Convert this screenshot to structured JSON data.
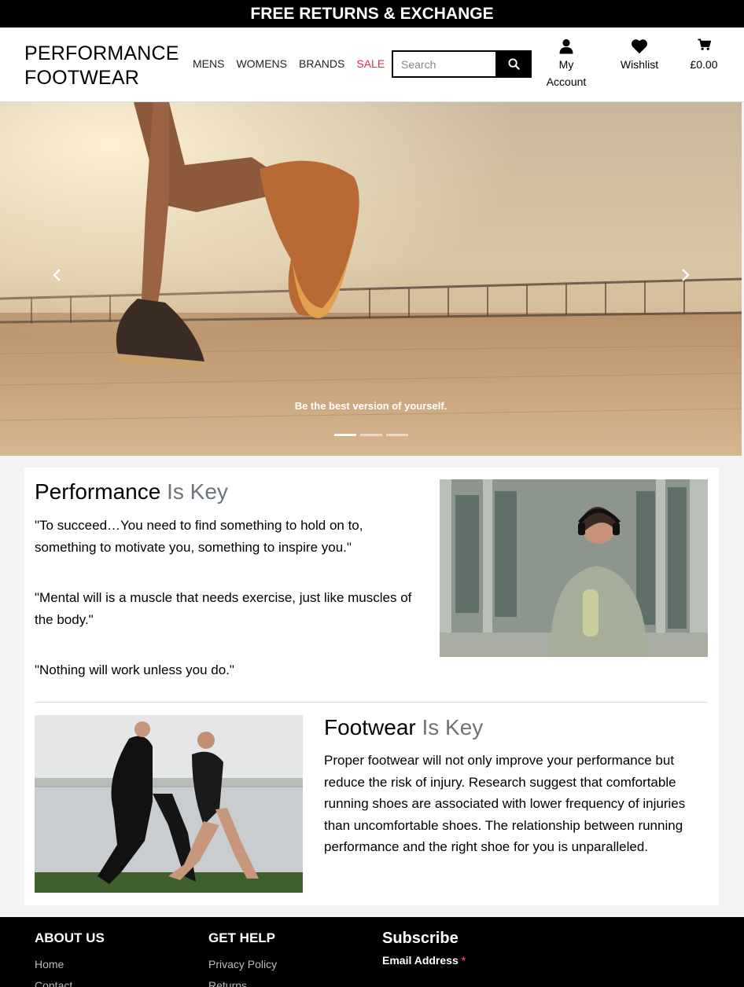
{
  "banner": {
    "text": "FREE RETURNS & EXCHANGE"
  },
  "header": {
    "logo_line1": "PERFORMANCE",
    "logo_line2": "FOOTWEAR",
    "nav": [
      "MENS",
      "WOMENS",
      "BRANDS",
      "SALE"
    ],
    "search_placeholder": "Search",
    "account_line1": "My",
    "account_line2": "Account",
    "wishlist_label": "Wishlist",
    "cart_total": "£0.00"
  },
  "hero": {
    "caption": "Be the best version of yourself.",
    "active_slide": 1,
    "slide_count": 3
  },
  "section1": {
    "title_main": "Performance",
    "title_muted": "Is Key",
    "quotes": [
      "\"To succeed…You need to find something to hold on to, something to motivate you, something to inspire you.\"",
      "\"Mental will is a muscle that needs exercise, just like muscles of the body.\"",
      "\"Nothing will work unless you do.\""
    ]
  },
  "section2": {
    "title_main": "Footwear",
    "title_muted": "Is Key",
    "body": "Proper footwear will not only improve your performance but reduce the risk of injury. Research suggest that comfortable running shoes are associated with lower frequency of injuries than uncomfortable shoes. The relationship between running performance and the right shoe for you is unparalleled."
  },
  "footer": {
    "about_title": "ABOUT US",
    "about_links": [
      "Home",
      "Contact"
    ],
    "help_title": "GET HELP",
    "help_links": [
      "Privacy Policy",
      "Returns"
    ],
    "subscribe_title": "Subscribe",
    "email_label": "Email Address",
    "required_mark": "*"
  },
  "colors": {
    "sale": "#e0304a",
    "muted": "#6c757d",
    "banner_bg": "#000000"
  }
}
